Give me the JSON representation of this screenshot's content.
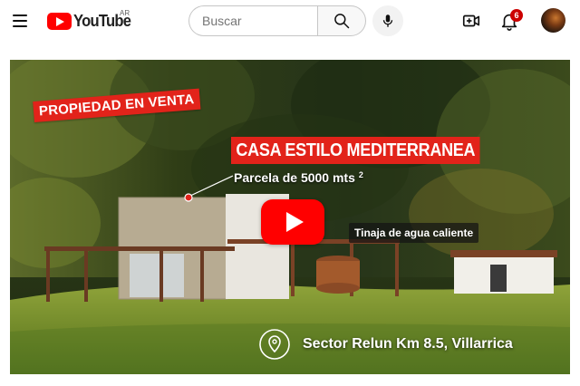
{
  "header": {
    "logo_text": "YouTube",
    "logo_country": "AR",
    "search_placeholder": "Buscar",
    "notification_count": "6",
    "icons": [
      "menu-icon",
      "youtube-logo-icon",
      "search-icon",
      "mic-icon",
      "create-video-icon",
      "bell-icon"
    ]
  },
  "video": {
    "banner_label": "PROPIEDAD EN VENTA",
    "title_overlay": "CASA ESTILO MEDITERRANEA",
    "parcel_text": "Parcela de 5000 mts",
    "parcel_superscript": "2",
    "feature_callout": "Tinaja de agua caliente",
    "location_text": "Sector Relun Km 8.5, Villarrica",
    "colors": {
      "accent_red": "#e2231a",
      "play_red": "#ff0000"
    }
  }
}
